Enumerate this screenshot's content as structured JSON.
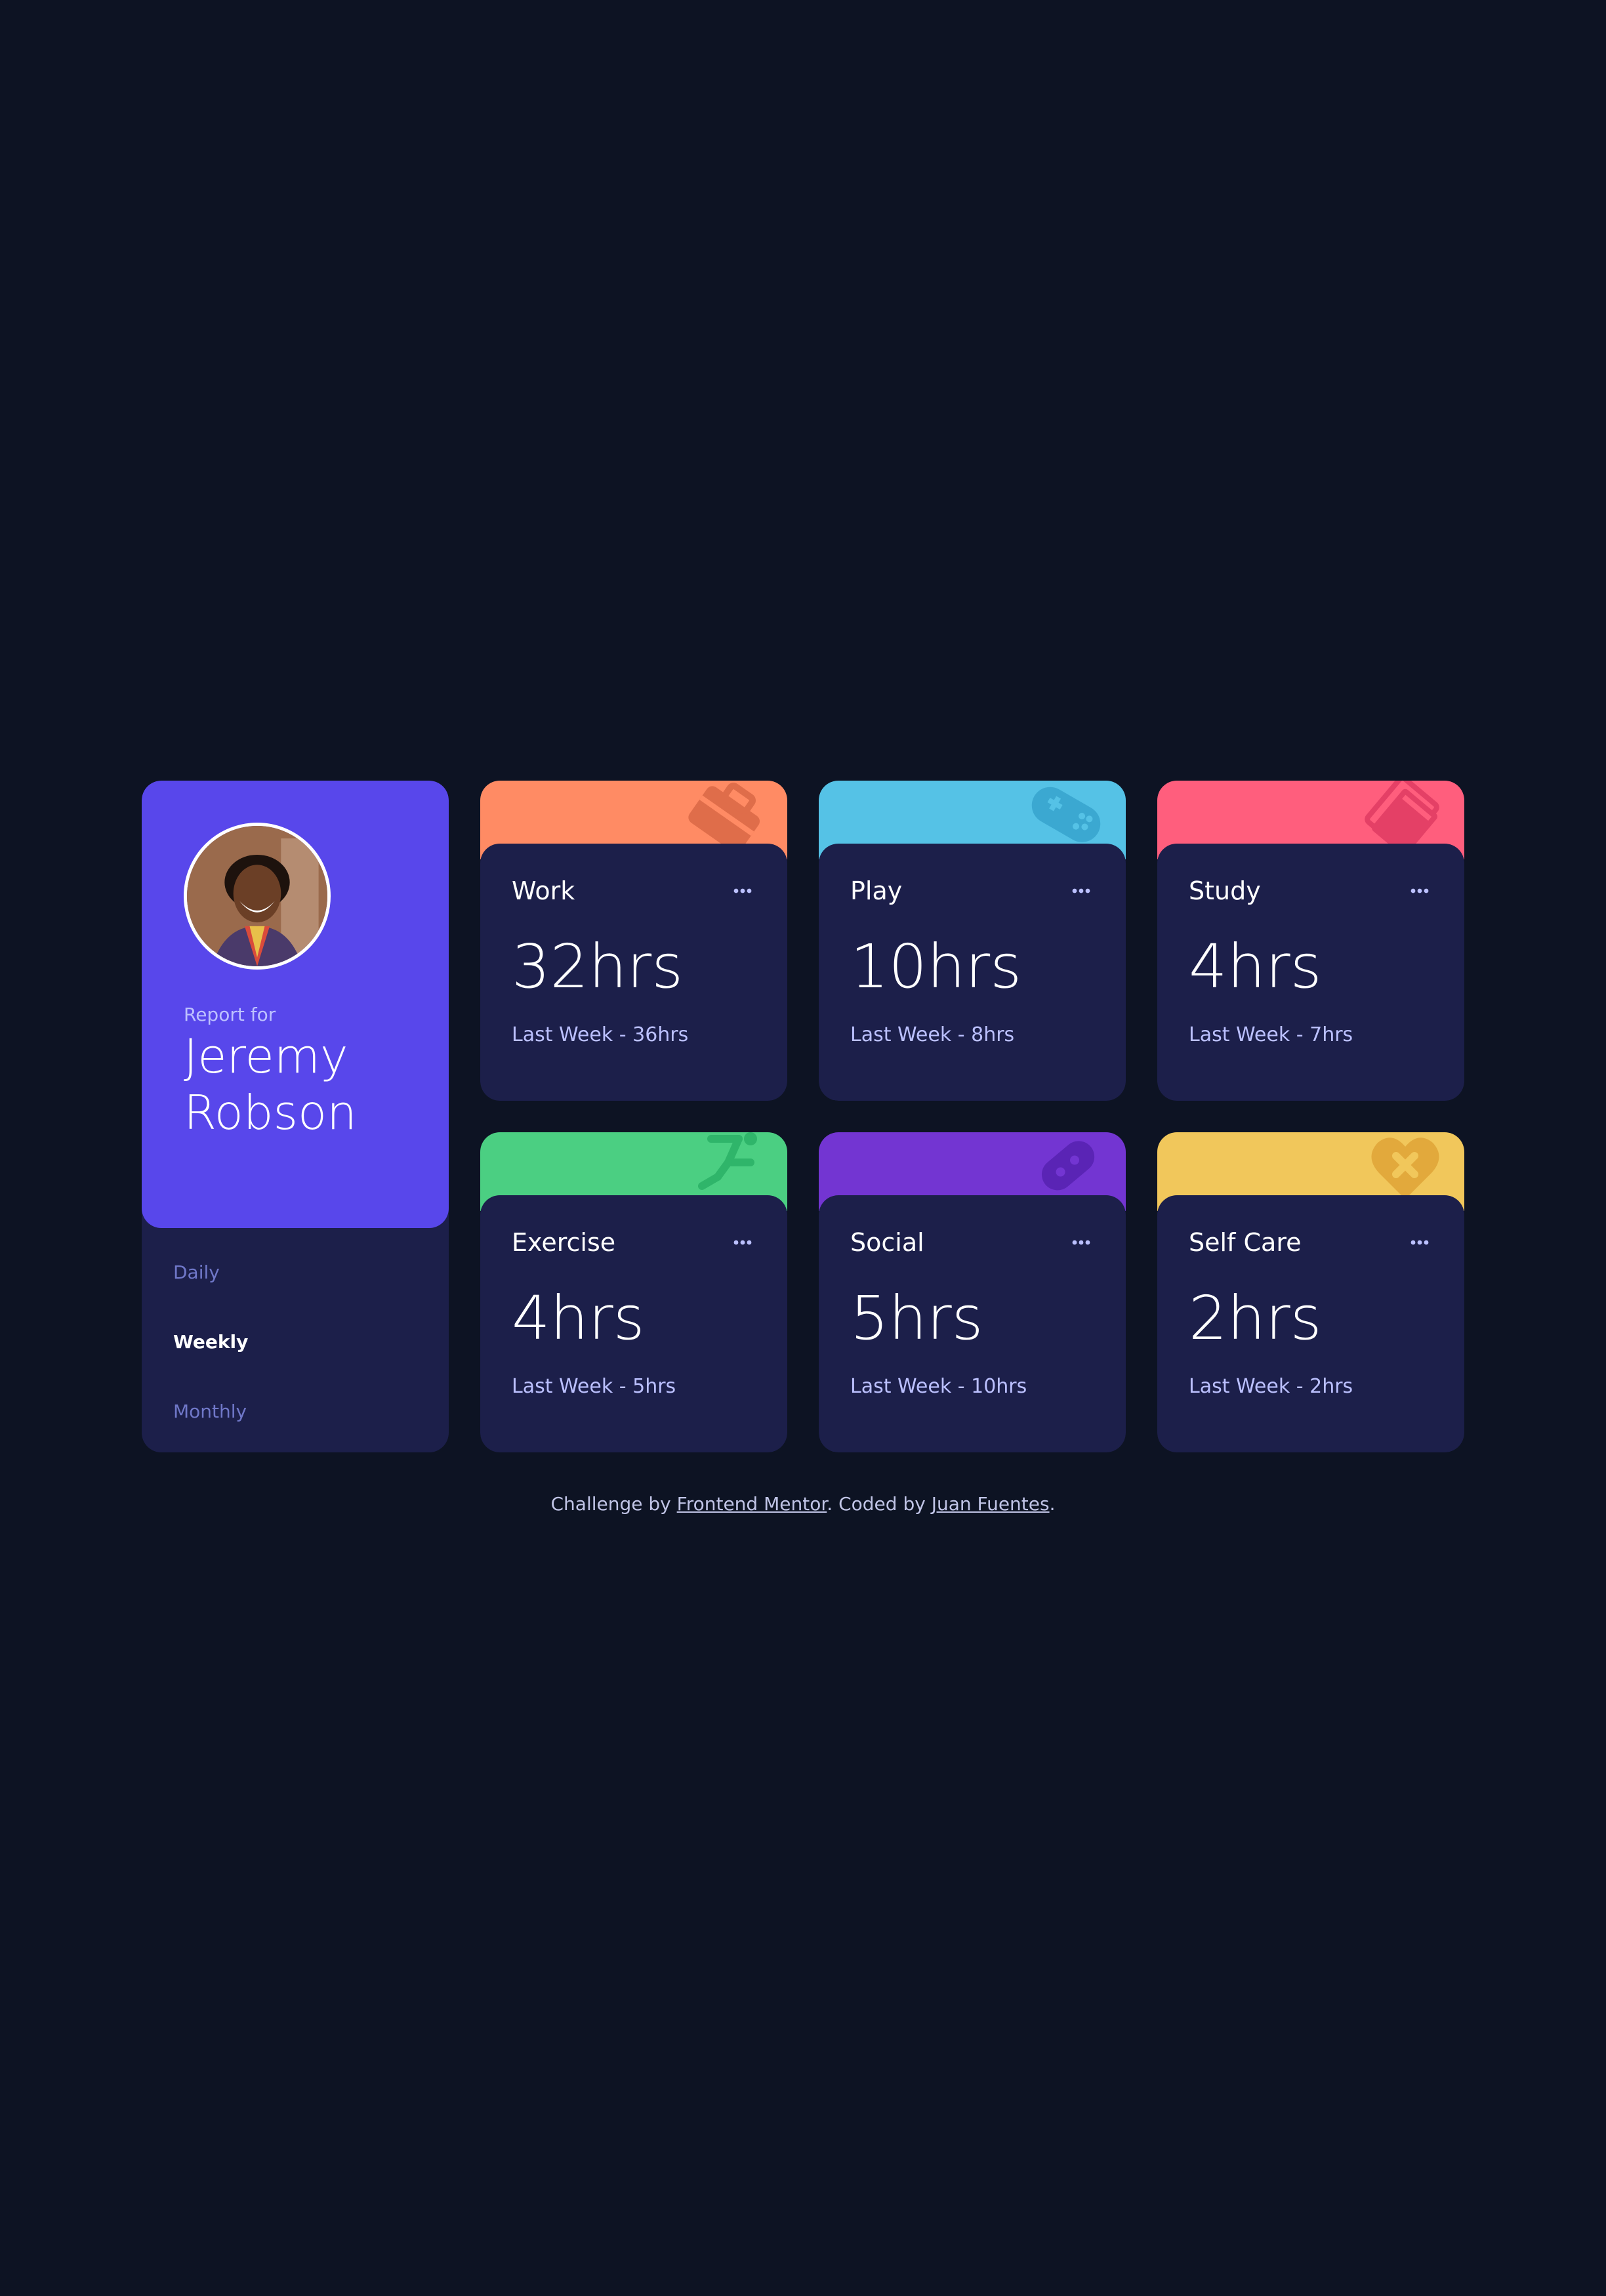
{
  "profile": {
    "report_label": "Report for",
    "user_name": "Jeremy Robson",
    "accent_color": "#5847eb"
  },
  "periods": [
    {
      "label": "Daily",
      "active": false
    },
    {
      "label": "Weekly",
      "active": true
    },
    {
      "label": "Monthly",
      "active": false
    }
  ],
  "activities": [
    {
      "title": "Work",
      "current": "32hrs",
      "previous": "Last Week - 36hrs",
      "color": "#ff8b64",
      "icon": "briefcase-icon"
    },
    {
      "title": "Play",
      "current": "10hrs",
      "previous": "Last Week - 8hrs",
      "color": "#55c2e6",
      "icon": "gamepad-icon"
    },
    {
      "title": "Study",
      "current": "4hrs",
      "previous": "Last Week - 7hrs",
      "color": "#ff5e7d",
      "icon": "book-icon"
    },
    {
      "title": "Exercise",
      "current": "4hrs",
      "previous": "Last Week - 5hrs",
      "color": "#4bcf82",
      "icon": "runner-icon"
    },
    {
      "title": "Social",
      "current": "5hrs",
      "previous": "Last Week - 10hrs",
      "color": "#7335d2",
      "icon": "bandage-social-icon"
    },
    {
      "title": "Self Care",
      "current": "2hrs",
      "previous": "Last Week - 2hrs",
      "color": "#f1c75b",
      "icon": "heart-cross-icon"
    }
  ],
  "attribution": {
    "prefix": "Challenge by ",
    "link1": "Frontend Mentor",
    "middle": ". Coded by ",
    "link2": "Juan Fuentes",
    "suffix": "."
  }
}
